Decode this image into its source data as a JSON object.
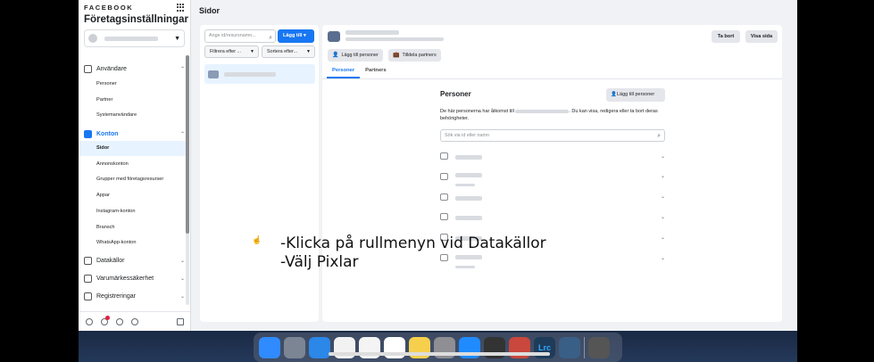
{
  "brand": "FACEBOOK",
  "business_settings_title": "Företagsinställningar",
  "sidebar": {
    "sections": [
      {
        "label": "Användare",
        "icon": "users-icon",
        "items": [
          "Personer",
          "Partner",
          "Systemanvändare"
        ]
      },
      {
        "label": "Konton",
        "icon": "accounts-icon",
        "items": [
          "Sidor",
          "Annonskonton",
          "Grupper med företagsresurser",
          "Appar",
          "Instagram-konton",
          "Bransch",
          "WhatsApp-konton"
        ]
      },
      {
        "label": "Datakällor",
        "icon": "data-sources-icon",
        "items": []
      },
      {
        "label": "Varumärkessäkerhet",
        "icon": "shield-icon",
        "items": []
      },
      {
        "label": "Registreringar",
        "icon": "registrations-icon",
        "items": []
      }
    ],
    "selected_item": "Sidor"
  },
  "page_title": "Sidor",
  "list_panel": {
    "search_placeholder": "Ange id/resursnamn...",
    "add_label": "Lägg till",
    "filter_label": "Filtrera efter ...",
    "sort_label": "Sortera efter..."
  },
  "detail": {
    "remove_label": "Ta bort",
    "view_label": "Visa sida",
    "add_people_label": "Lägg till personer",
    "assign_partners_label": "Tilldela partners",
    "tabs": [
      "Personer",
      "Partners"
    ],
    "active_tab": "Personer",
    "people_title": "Personer",
    "people_add_label": "Lägg till personer",
    "people_desc_prefix": "De här personerna har åtkomst till",
    "people_desc_suffix": ". Du kan visa, redigera eller ta bort deras behörigheter.",
    "search_placeholder": "Sök via id eller namn",
    "people_rows": 6
  },
  "caption": {
    "line1": "-Klicka på rullmenyn vid Datakällor",
    "line2": "-Välj Pixlar"
  },
  "dock_icons": [
    "finder-icon",
    "launchpad-icon",
    "safari-icon",
    "calendar-icon",
    "reminders-icon",
    "freeform-icon",
    "notes-icon",
    "system-settings-icon",
    "app-store-icon",
    "final-cut-icon",
    "affinity-icon",
    "lightroom-classic-icon",
    "quicktime-icon",
    "trash-icon"
  ],
  "dock_labels": {
    "lightroom": "Lrc"
  },
  "colors": {
    "accent": "#1877f2",
    "selected_bg": "#e7f3ff"
  }
}
